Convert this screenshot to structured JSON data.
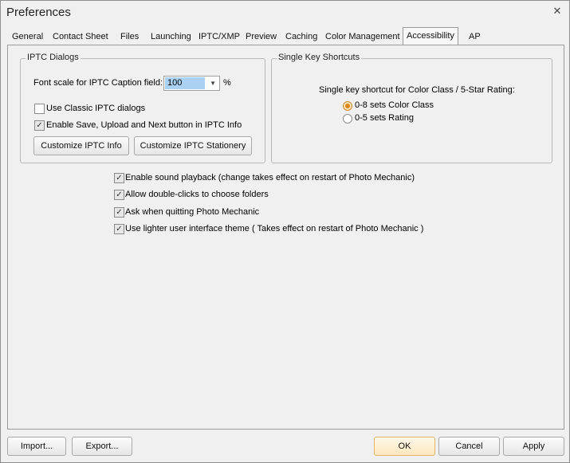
{
  "window": {
    "title": "Preferences",
    "close_glyph": "✕"
  },
  "tabs": [
    {
      "label": "General"
    },
    {
      "label": "Contact Sheet"
    },
    {
      "label": "Files"
    },
    {
      "label": "Launching"
    },
    {
      "label": "IPTC/XMP"
    },
    {
      "label": "Preview"
    },
    {
      "label": "Caching"
    },
    {
      "label": "Color Management"
    },
    {
      "label": "Accessibility",
      "active": true
    },
    {
      "label": "AP"
    }
  ],
  "iptc_dialogs": {
    "title": "IPTC Dialogs",
    "font_scale_label": "Font scale for IPTC Caption field:",
    "font_scale_value": "100",
    "font_scale_unit": "%",
    "use_classic_label": "Use Classic IPTC dialogs",
    "use_classic_checked": false,
    "enable_save_label": "Enable Save, Upload and Next button in IPTC Info",
    "enable_save_checked": true,
    "customize_info_button": "Customize IPTC Info",
    "customize_stationery_button": "Customize IPTC Stationery"
  },
  "single_key": {
    "title": "Single Key Shortcuts",
    "description": "Single key shortcut for Color Class / 5-Star Rating:",
    "option_color_class": "0-8 sets Color Class",
    "option_rating": "0-5 sets Rating",
    "selected": "color_class"
  },
  "options": [
    {
      "label": "Enable sound playback (change takes effect on restart of Photo Mechanic)",
      "checked": true
    },
    {
      "label": "Allow double-clicks to choose folders",
      "checked": true
    },
    {
      "label": "Ask when quitting Photo Mechanic",
      "checked": true
    },
    {
      "label": "Use lighter user interface theme ( Takes effect on restart of Photo Mechanic )",
      "checked": true
    }
  ],
  "footer": {
    "import": "Import...",
    "export": "Export...",
    "ok": "OK",
    "cancel": "Cancel",
    "apply": "Apply"
  },
  "colors": {
    "default_button": "#fce7bf",
    "selected_text_bg": "#aad1f2",
    "radio_accent": "#d9861a"
  }
}
